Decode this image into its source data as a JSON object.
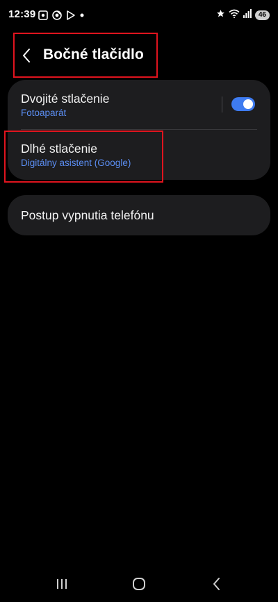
{
  "status_bar": {
    "time": "12:39",
    "left_icons": [
      "screenshot-icon",
      "chrome-icon",
      "play-store-icon",
      "notification-dot-icon"
    ],
    "right_icons": [
      "star-icon",
      "wifi-icon",
      "signal-icon"
    ],
    "battery": "46"
  },
  "header": {
    "title": "Bočné tlačidlo",
    "back_icon": "chevron-left-icon"
  },
  "settings": {
    "double_press": {
      "title": "Dvojité stlačenie",
      "subtitle": "Fotoaparát",
      "toggle_on": true
    },
    "long_press": {
      "title": "Dlhé stlačenie",
      "subtitle": "Digitálny asistent (Google)"
    },
    "power_off": {
      "title": "Postup vypnutia telefónu"
    }
  },
  "nav_bar": {
    "icons": [
      "recents-icon",
      "home-icon",
      "back-icon"
    ]
  },
  "colors": {
    "background": "#000000",
    "card": "#1d1d1f",
    "accent": "#3e7bf0",
    "subtitle": "#5b8ef3",
    "highlight": "#e0141e"
  }
}
